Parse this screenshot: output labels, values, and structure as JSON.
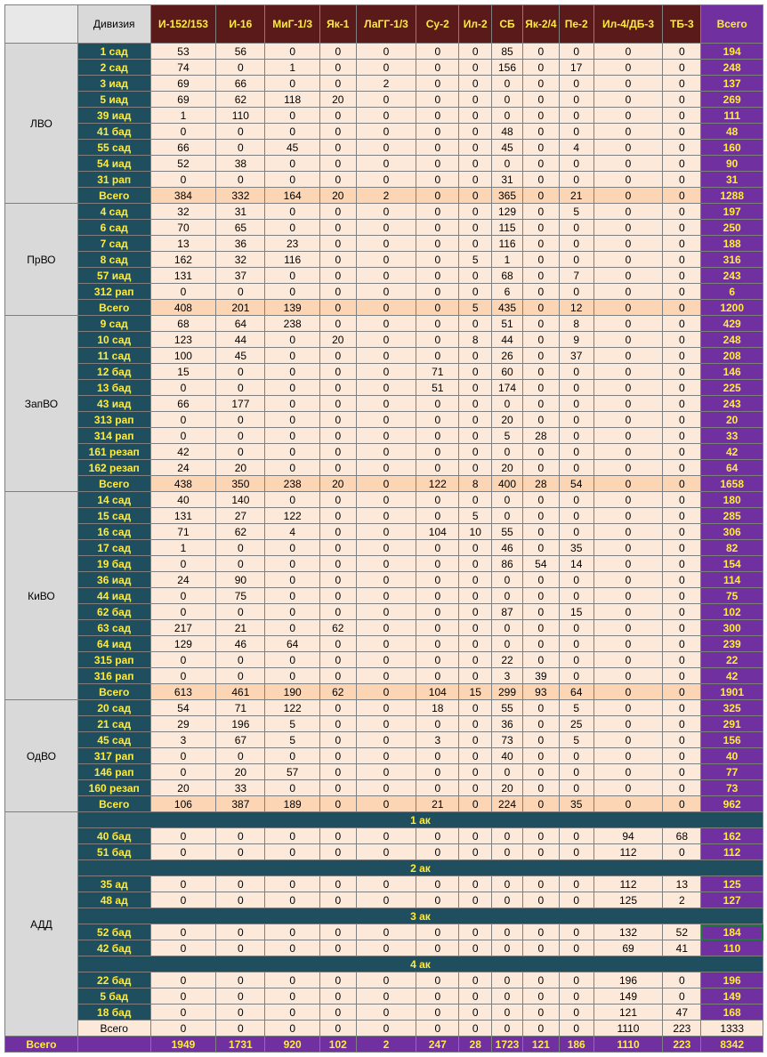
{
  "header": {
    "division_label": "Дивизия",
    "aircraft": [
      "И-152/153",
      "И-16",
      "МиГ-1/3",
      "Як-1",
      "ЛаГГ-1/3",
      "Су-2",
      "Ил-2",
      "СБ",
      "Як-2/4",
      "Пе-2",
      "Ил-4/ДБ-3",
      "ТБ-3"
    ],
    "total_label": "Всего"
  },
  "districts": [
    {
      "name": "ЛВО",
      "rows": [
        {
          "unit": "1 сад",
          "values": [
            53,
            56,
            0,
            0,
            0,
            0,
            0,
            85,
            0,
            0,
            0,
            0
          ],
          "total": 194
        },
        {
          "unit": "2 сад",
          "values": [
            74,
            0,
            1,
            0,
            0,
            0,
            0,
            156,
            0,
            17,
            0,
            0
          ],
          "total": 248
        },
        {
          "unit": "3 иад",
          "values": [
            69,
            66,
            0,
            0,
            2,
            0,
            0,
            0,
            0,
            0,
            0,
            0
          ],
          "total": 137
        },
        {
          "unit": "5 иад",
          "values": [
            69,
            62,
            118,
            20,
            0,
            0,
            0,
            0,
            0,
            0,
            0,
            0
          ],
          "total": 269
        },
        {
          "unit": "39 иад",
          "values": [
            1,
            110,
            0,
            0,
            0,
            0,
            0,
            0,
            0,
            0,
            0,
            0
          ],
          "total": 111
        },
        {
          "unit": "41 бад",
          "values": [
            0,
            0,
            0,
            0,
            0,
            0,
            0,
            48,
            0,
            0,
            0,
            0
          ],
          "total": 48
        },
        {
          "unit": "55 сад",
          "values": [
            66,
            0,
            45,
            0,
            0,
            0,
            0,
            45,
            0,
            4,
            0,
            0
          ],
          "total": 160
        },
        {
          "unit": "54 иад",
          "values": [
            52,
            38,
            0,
            0,
            0,
            0,
            0,
            0,
            0,
            0,
            0,
            0
          ],
          "total": 90
        },
        {
          "unit": "31 рап",
          "values": [
            0,
            0,
            0,
            0,
            0,
            0,
            0,
            31,
            0,
            0,
            0,
            0
          ],
          "total": 31
        },
        {
          "unit": "Всего",
          "values": [
            384,
            332,
            164,
            20,
            2,
            0,
            0,
            365,
            0,
            21,
            0,
            0
          ],
          "total": 1288,
          "sum": true
        }
      ]
    },
    {
      "name": "ПрВО",
      "rows": [
        {
          "unit": "4 сад",
          "values": [
            32,
            31,
            0,
            0,
            0,
            0,
            0,
            129,
            0,
            5,
            0,
            0
          ],
          "total": 197
        },
        {
          "unit": "6 сад",
          "values": [
            70,
            65,
            0,
            0,
            0,
            0,
            0,
            115,
            0,
            0,
            0,
            0
          ],
          "total": 250
        },
        {
          "unit": "7 сад",
          "values": [
            13,
            36,
            23,
            0,
            0,
            0,
            0,
            116,
            0,
            0,
            0,
            0
          ],
          "total": 188
        },
        {
          "unit": "8 сад",
          "values": [
            162,
            32,
            116,
            0,
            0,
            0,
            5,
            1,
            0,
            0,
            0,
            0
          ],
          "total": 316
        },
        {
          "unit": "57 иад",
          "values": [
            131,
            37,
            0,
            0,
            0,
            0,
            0,
            68,
            0,
            7,
            0,
            0
          ],
          "total": 243
        },
        {
          "unit": "312 рап",
          "values": [
            0,
            0,
            0,
            0,
            0,
            0,
            0,
            6,
            0,
            0,
            0,
            0
          ],
          "total": 6
        },
        {
          "unit": "Всего",
          "values": [
            408,
            201,
            139,
            0,
            0,
            0,
            5,
            435,
            0,
            12,
            0,
            0
          ],
          "total": 1200,
          "sum": true
        }
      ]
    },
    {
      "name": "ЗапВО",
      "rows": [
        {
          "unit": "9 сад",
          "values": [
            68,
            64,
            238,
            0,
            0,
            0,
            0,
            51,
            0,
            8,
            0,
            0
          ],
          "total": 429
        },
        {
          "unit": "10 сад",
          "values": [
            123,
            44,
            0,
            20,
            0,
            0,
            8,
            44,
            0,
            9,
            0,
            0
          ],
          "total": 248
        },
        {
          "unit": "11 сад",
          "values": [
            100,
            45,
            0,
            0,
            0,
            0,
            0,
            26,
            0,
            37,
            0,
            0
          ],
          "total": 208
        },
        {
          "unit": "12 бад",
          "values": [
            15,
            0,
            0,
            0,
            0,
            71,
            0,
            60,
            0,
            0,
            0,
            0
          ],
          "total": 146
        },
        {
          "unit": "13 бад",
          "values": [
            0,
            0,
            0,
            0,
            0,
            51,
            0,
            174,
            0,
            0,
            0,
            0
          ],
          "total": 225
        },
        {
          "unit": "43 иад",
          "values": [
            66,
            177,
            0,
            0,
            0,
            0,
            0,
            0,
            0,
            0,
            0,
            0
          ],
          "total": 243
        },
        {
          "unit": "313 рап",
          "values": [
            0,
            0,
            0,
            0,
            0,
            0,
            0,
            20,
            0,
            0,
            0,
            0
          ],
          "total": 20
        },
        {
          "unit": "314 рап",
          "values": [
            0,
            0,
            0,
            0,
            0,
            0,
            0,
            5,
            28,
            0,
            0,
            0
          ],
          "total": 33
        },
        {
          "unit": "161 резап",
          "values": [
            42,
            0,
            0,
            0,
            0,
            0,
            0,
            0,
            0,
            0,
            0,
            0
          ],
          "total": 42
        },
        {
          "unit": "162 резап",
          "values": [
            24,
            20,
            0,
            0,
            0,
            0,
            0,
            20,
            0,
            0,
            0,
            0
          ],
          "total": 64
        },
        {
          "unit": "Всего",
          "values": [
            438,
            350,
            238,
            20,
            0,
            122,
            8,
            400,
            28,
            54,
            0,
            0
          ],
          "total": 1658,
          "sum": true
        }
      ]
    },
    {
      "name": "КиВО",
      "rows": [
        {
          "unit": "14 сад",
          "values": [
            40,
            140,
            0,
            0,
            0,
            0,
            0,
            0,
            0,
            0,
            0,
            0
          ],
          "total": 180
        },
        {
          "unit": "15 сад",
          "values": [
            131,
            27,
            122,
            0,
            0,
            0,
            5,
            0,
            0,
            0,
            0,
            0
          ],
          "total": 285
        },
        {
          "unit": "16 сад",
          "values": [
            71,
            62,
            4,
            0,
            0,
            104,
            10,
            55,
            0,
            0,
            0,
            0
          ],
          "total": 306
        },
        {
          "unit": "17 сад",
          "values": [
            1,
            0,
            0,
            0,
            0,
            0,
            0,
            46,
            0,
            35,
            0,
            0
          ],
          "total": 82
        },
        {
          "unit": "19 бад",
          "values": [
            0,
            0,
            0,
            0,
            0,
            0,
            0,
            86,
            54,
            14,
            0,
            0
          ],
          "total": 154
        },
        {
          "unit": "36 иад",
          "values": [
            24,
            90,
            0,
            0,
            0,
            0,
            0,
            0,
            0,
            0,
            0,
            0
          ],
          "total": 114
        },
        {
          "unit": "44 иад",
          "values": [
            0,
            75,
            0,
            0,
            0,
            0,
            0,
            0,
            0,
            0,
            0,
            0
          ],
          "total": 75
        },
        {
          "unit": "62 бад",
          "values": [
            0,
            0,
            0,
            0,
            0,
            0,
            0,
            87,
            0,
            15,
            0,
            0
          ],
          "total": 102
        },
        {
          "unit": "63 сад",
          "values": [
            217,
            21,
            0,
            62,
            0,
            0,
            0,
            0,
            0,
            0,
            0,
            0
          ],
          "total": 300
        },
        {
          "unit": "64 иад",
          "values": [
            129,
            46,
            64,
            0,
            0,
            0,
            0,
            0,
            0,
            0,
            0,
            0
          ],
          "total": 239
        },
        {
          "unit": "315 рап",
          "values": [
            0,
            0,
            0,
            0,
            0,
            0,
            0,
            22,
            0,
            0,
            0,
            0
          ],
          "total": 22
        },
        {
          "unit": "316 рап",
          "values": [
            0,
            0,
            0,
            0,
            0,
            0,
            0,
            3,
            39,
            0,
            0,
            0
          ],
          "total": 42
        },
        {
          "unit": "Всего",
          "values": [
            613,
            461,
            190,
            62,
            0,
            104,
            15,
            299,
            93,
            64,
            0,
            0
          ],
          "total": 1901,
          "sum": true
        }
      ]
    },
    {
      "name": "ОдВО",
      "rows": [
        {
          "unit": "20 сад",
          "values": [
            54,
            71,
            122,
            0,
            0,
            18,
            0,
            55,
            0,
            5,
            0,
            0
          ],
          "total": 325
        },
        {
          "unit": "21 сад",
          "values": [
            29,
            196,
            5,
            0,
            0,
            0,
            0,
            36,
            0,
            25,
            0,
            0
          ],
          "total": 291
        },
        {
          "unit": "45 сад",
          "values": [
            3,
            67,
            5,
            0,
            0,
            3,
            0,
            73,
            0,
            5,
            0,
            0
          ],
          "total": 156
        },
        {
          "unit": "317 рап",
          "values": [
            0,
            0,
            0,
            0,
            0,
            0,
            0,
            40,
            0,
            0,
            0,
            0
          ],
          "total": 40
        },
        {
          "unit": "146 рап",
          "values": [
            0,
            20,
            57,
            0,
            0,
            0,
            0,
            0,
            0,
            0,
            0,
            0
          ],
          "total": 77
        },
        {
          "unit": "160 резап",
          "values": [
            20,
            33,
            0,
            0,
            0,
            0,
            0,
            20,
            0,
            0,
            0,
            0
          ],
          "total": 73
        },
        {
          "unit": "Всего",
          "values": [
            106,
            387,
            189,
            0,
            0,
            21,
            0,
            224,
            0,
            35,
            0,
            0
          ],
          "total": 962,
          "sum": true
        }
      ]
    },
    {
      "name": "АДД",
      "adf": true,
      "rows": [
        {
          "corps": "1 ак"
        },
        {
          "unit": "40 бад",
          "values": [
            0,
            0,
            0,
            0,
            0,
            0,
            0,
            0,
            0,
            0,
            94,
            68
          ],
          "total": 162
        },
        {
          "unit": "51 бад",
          "values": [
            0,
            0,
            0,
            0,
            0,
            0,
            0,
            0,
            0,
            0,
            112,
            0
          ],
          "total": 112
        },
        {
          "corps": "2 ак"
        },
        {
          "unit": "35 ад",
          "values": [
            0,
            0,
            0,
            0,
            0,
            0,
            0,
            0,
            0,
            0,
            112,
            13
          ],
          "total": 125
        },
        {
          "unit": "48 ад",
          "values": [
            0,
            0,
            0,
            0,
            0,
            0,
            0,
            0,
            0,
            0,
            125,
            2
          ],
          "total": 127
        },
        {
          "corps": "3 ак"
        },
        {
          "unit": "52 бад",
          "values": [
            0,
            0,
            0,
            0,
            0,
            0,
            0,
            0,
            0,
            0,
            132,
            52
          ],
          "total": 184,
          "selected": true
        },
        {
          "unit": "42 бад",
          "values": [
            0,
            0,
            0,
            0,
            0,
            0,
            0,
            0,
            0,
            0,
            69,
            41
          ],
          "total": 110
        },
        {
          "corps": "4 ак"
        },
        {
          "unit": "22 бад",
          "values": [
            0,
            0,
            0,
            0,
            0,
            0,
            0,
            0,
            0,
            0,
            196,
            0
          ],
          "total": 196
        },
        {
          "unit": "5 бад",
          "values": [
            0,
            0,
            0,
            0,
            0,
            0,
            0,
            0,
            0,
            0,
            149,
            0
          ],
          "total": 149
        },
        {
          "unit": "18 бад",
          "values": [
            0,
            0,
            0,
            0,
            0,
            0,
            0,
            0,
            0,
            0,
            121,
            47
          ],
          "total": 168
        },
        {
          "unit": "Всего",
          "values": [
            0,
            0,
            0,
            0,
            0,
            0,
            0,
            0,
            0,
            0,
            1110,
            223
          ],
          "total": 1333,
          "sum": true
        }
      ]
    }
  ],
  "grand_total": {
    "label": "Всего",
    "values": [
      1949,
      1731,
      920,
      102,
      2,
      247,
      28,
      1723,
      121,
      186,
      1110,
      223
    ],
    "total": 8342
  },
  "colors": {
    "header_plane": "#5a1a1a",
    "header_text": "#ffeb3b",
    "total_column": "#7030a0",
    "unit_column": "#1f4e5f",
    "value_cell": "#fde9d9",
    "sum_row": "#fcd5b4",
    "district_column": "#d9d9d9"
  }
}
